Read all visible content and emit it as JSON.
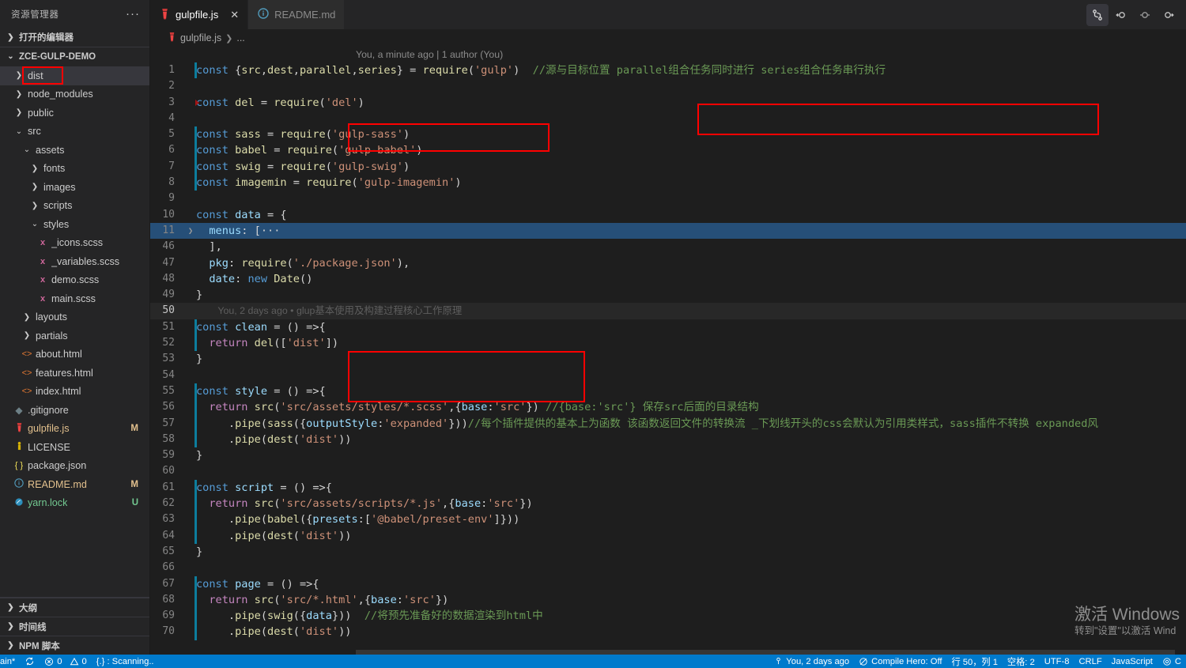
{
  "sidebar": {
    "title": "资源管理器",
    "more_label": "···",
    "open_editors_label": "打开的编辑器",
    "project_label": "ZCE-GULP-DEMO",
    "tree": [
      {
        "name": "dist",
        "depth": 1,
        "type": "folder",
        "expanded": false,
        "selected": true,
        "icon": "chevron-right-icon",
        "badge": ""
      },
      {
        "name": "node_modules",
        "depth": 1,
        "type": "folder",
        "expanded": false,
        "selected": false,
        "icon": "chevron-right-icon",
        "badge": ""
      },
      {
        "name": "public",
        "depth": 1,
        "type": "folder",
        "expanded": false,
        "selected": false,
        "icon": "chevron-right-icon",
        "badge": ""
      },
      {
        "name": "src",
        "depth": 1,
        "type": "folder",
        "expanded": true,
        "selected": false,
        "icon": "chevron-down-icon",
        "badge": ""
      },
      {
        "name": "assets",
        "depth": 2,
        "type": "folder",
        "expanded": true,
        "selected": false,
        "icon": "chevron-down-icon",
        "badge": ""
      },
      {
        "name": "fonts",
        "depth": 3,
        "type": "folder",
        "expanded": false,
        "selected": false,
        "icon": "chevron-right-icon",
        "badge": ""
      },
      {
        "name": "images",
        "depth": 3,
        "type": "folder",
        "expanded": false,
        "selected": false,
        "icon": "chevron-right-icon",
        "badge": ""
      },
      {
        "name": "scripts",
        "depth": 3,
        "type": "folder",
        "expanded": false,
        "selected": false,
        "icon": "chevron-right-icon",
        "badge": ""
      },
      {
        "name": "styles",
        "depth": 3,
        "type": "folder",
        "expanded": true,
        "selected": false,
        "icon": "chevron-down-icon",
        "badge": ""
      },
      {
        "name": "_icons.scss",
        "depth": 4,
        "type": "file",
        "icon": "scss-icon",
        "badge": ""
      },
      {
        "name": "_variables.scss",
        "depth": 4,
        "type": "file",
        "icon": "scss-icon",
        "badge": ""
      },
      {
        "name": "demo.scss",
        "depth": 4,
        "type": "file",
        "icon": "scss-icon",
        "badge": ""
      },
      {
        "name": "main.scss",
        "depth": 4,
        "type": "file",
        "icon": "scss-icon",
        "badge": ""
      },
      {
        "name": "layouts",
        "depth": 2,
        "type": "folder",
        "expanded": false,
        "selected": false,
        "icon": "chevron-right-icon",
        "badge": ""
      },
      {
        "name": "partials",
        "depth": 2,
        "type": "folder",
        "expanded": false,
        "selected": false,
        "icon": "chevron-right-icon",
        "badge": ""
      },
      {
        "name": "about.html",
        "depth": 2,
        "type": "file",
        "icon": "html-icon",
        "badge": ""
      },
      {
        "name": "features.html",
        "depth": 2,
        "type": "file",
        "icon": "html-icon",
        "badge": ""
      },
      {
        "name": "index.html",
        "depth": 2,
        "type": "file",
        "icon": "html-icon",
        "badge": ""
      },
      {
        "name": ".gitignore",
        "depth": 1,
        "type": "file",
        "icon": "git-icon",
        "badge": ""
      },
      {
        "name": "gulpfile.js",
        "depth": 1,
        "type": "file",
        "icon": "gulp-icon",
        "badge": "M"
      },
      {
        "name": "LICENSE",
        "depth": 1,
        "type": "file",
        "icon": "license-icon",
        "badge": ""
      },
      {
        "name": "package.json",
        "depth": 1,
        "type": "file",
        "icon": "json-icon",
        "badge": ""
      },
      {
        "name": "README.md",
        "depth": 1,
        "type": "file",
        "icon": "markdown-icon",
        "badge": "M"
      },
      {
        "name": "yarn.lock",
        "depth": 1,
        "type": "file",
        "icon": "yarn-icon",
        "badge": "U"
      }
    ],
    "panels": [
      {
        "label": "大纲"
      },
      {
        "label": "时间线"
      },
      {
        "label": "NPM 脚本"
      }
    ]
  },
  "tabs": [
    {
      "label": "gulpfile.js",
      "icon": "gulp-icon",
      "active": true,
      "close_label": "✕"
    },
    {
      "label": "README.md",
      "icon": "info-icon",
      "active": false,
      "close_label": ""
    }
  ],
  "editor_actions": [
    {
      "name": "source-control-graph-icon",
      "active": true
    },
    {
      "name": "split-editor-left-icon",
      "active": false
    },
    {
      "name": "split-editor-center-icon",
      "active": false
    },
    {
      "name": "split-editor-right-icon",
      "active": false
    }
  ],
  "breadcrumb": {
    "file": "gulpfile.js",
    "separator": "❯",
    "rest": "..."
  },
  "blame_top": "You, a minute ago | 1 author (You)",
  "blame_inline_50": "You, 2 days ago • glup基本使用及构建过程核心工作原理",
  "annotations": [
    {
      "id": "dist-folder-box"
    },
    {
      "id": "del-require-box"
    },
    {
      "id": "header-comment-box"
    },
    {
      "id": "clean-task-box"
    }
  ],
  "code_lines": [
    {
      "n": "1",
      "text": "const {src,dest,parallel,series} = require('gulp')  //源与目标位置 parallel组合任务同时进行 series组合任务串行执行",
      "diff": "mod"
    },
    {
      "n": "2",
      "text": "",
      "diff": ""
    },
    {
      "n": "3",
      "text": "const del = require('del')",
      "diff": "tri"
    },
    {
      "n": "4",
      "text": "",
      "diff": ""
    },
    {
      "n": "5",
      "text": "const sass = require('gulp-sass')",
      "diff": "mod"
    },
    {
      "n": "6",
      "text": "const babel = require('gulp-babel')",
      "diff": "mod"
    },
    {
      "n": "7",
      "text": "const swig = require('gulp-swig')",
      "diff": "mod"
    },
    {
      "n": "8",
      "text": "const imagemin = require('gulp-imagemin')",
      "diff": "mod"
    },
    {
      "n": "9",
      "text": "",
      "diff": ""
    },
    {
      "n": "10",
      "text": "const data = {",
      "diff": ""
    },
    {
      "n": "11",
      "text": "  menus: [···",
      "diff": ""
    },
    {
      "n": "46",
      "text": "  ],",
      "diff": ""
    },
    {
      "n": "47",
      "text": "  pkg: require('./package.json'),",
      "diff": ""
    },
    {
      "n": "48",
      "text": "  date: new Date()",
      "diff": ""
    },
    {
      "n": "49",
      "text": "}",
      "diff": ""
    },
    {
      "n": "50",
      "text": "",
      "diff": ""
    },
    {
      "n": "51",
      "text": "const clean = () =>{",
      "diff": "mod"
    },
    {
      "n": "52",
      "text": "  return del(['dist'])",
      "diff": "mod"
    },
    {
      "n": "53",
      "text": "}",
      "diff": ""
    },
    {
      "n": "54",
      "text": "",
      "diff": ""
    },
    {
      "n": "55",
      "text": "const style = () =>{",
      "diff": "mod"
    },
    {
      "n": "56",
      "text": "  return src('src/assets/styles/*.scss',{base:'src'}) //{base:'src'} 保存src后面的目录结构",
      "diff": "mod"
    },
    {
      "n": "57",
      "text": "     .pipe(sass({outputStyle:'expanded'}))//每个插件提供的基本上为函数 该函数返回文件的转换流 _下划线开头的css会默认为引用类样式，sass插件不转换 expanded风",
      "diff": "mod"
    },
    {
      "n": "58",
      "text": "     .pipe(dest('dist'))",
      "diff": "mod"
    },
    {
      "n": "59",
      "text": "}",
      "diff": ""
    },
    {
      "n": "60",
      "text": "",
      "diff": ""
    },
    {
      "n": "61",
      "text": "const script = () =>{",
      "diff": "mod"
    },
    {
      "n": "62",
      "text": "  return src('src/assets/scripts/*.js',{base:'src'})",
      "diff": "mod"
    },
    {
      "n": "63",
      "text": "     .pipe(babel({presets:['@babel/preset-env']}))",
      "diff": "mod"
    },
    {
      "n": "64",
      "text": "     .pipe(dest('dist'))",
      "diff": "mod"
    },
    {
      "n": "65",
      "text": "}",
      "diff": ""
    },
    {
      "n": "66",
      "text": "",
      "diff": ""
    },
    {
      "n": "67",
      "text": "const page = () =>{",
      "diff": "mod"
    },
    {
      "n": "68",
      "text": "  return src('src/*.html',{base:'src'})",
      "diff": "mod"
    },
    {
      "n": "69",
      "text": "     .pipe(swig({data}))  //将预先准备好的数据渲染到html中",
      "diff": "mod"
    },
    {
      "n": "70",
      "text": "     .pipe(dest('dist'))",
      "diff": "mod"
    }
  ],
  "status_bar": {
    "branch": "ain*",
    "sync_icon": "sync-icon",
    "errors": "0",
    "warnings": "0",
    "scanning": "{.} : Scanning..",
    "blame": "You, 2 days ago",
    "compile_hero": "Compile Hero: Off",
    "position": "行 50，列 1",
    "spaces": "空格: 2",
    "encoding": "UTF-8",
    "eol": "CRLF",
    "language": "JavaScript",
    "bell": "bell-icon"
  },
  "watermark": {
    "line1": "激活 Windows",
    "line2": "转到\"设置\"以激活 Wind"
  },
  "colors": {
    "accent": "#007acc",
    "annotation": "#ff0000",
    "sidebar_bg": "#252526",
    "editor_bg": "#1e1e1e"
  }
}
